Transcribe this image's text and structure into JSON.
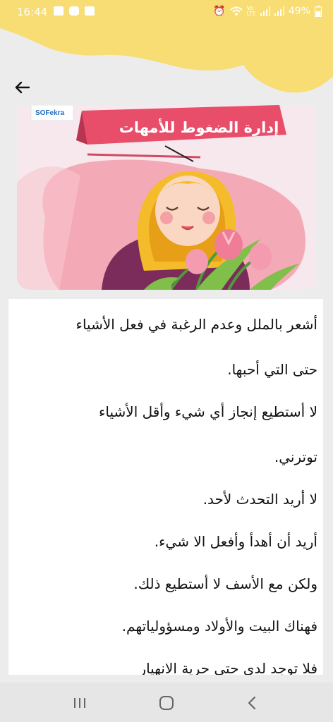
{
  "status_bar": {
    "time": "16:44",
    "battery": "49%",
    "icons": [
      "folder-icon",
      "message-icon",
      "image-icon",
      "alarm-icon",
      "wifi-icon",
      "volte-icon",
      "signal-icon",
      "signal-icon"
    ]
  },
  "header": {
    "back_icon": "arrow-left-icon",
    "accent_color": "#f7dd73"
  },
  "hero": {
    "title": "إدارة الضغوط للأمهات",
    "brand": "SOFekra",
    "banner_color": "#e84d6a"
  },
  "article": {
    "lines": [
      "أشعر بالملل وعدم الرغبة في فعل الأشياء",
      "حتى التي أحبها.",
      "لا أستطيع إنجاز أي شيء وأقل الأشياء",
      "توترني.",
      "لا أريد التحدث لأحد.",
      "أريد أن أهدأ وأفعل الا شيء.",
      "ولكن مع الأسف لا أستطيع ذلك.",
      "فهناك البيت والأولاد ومسؤولياتهم.",
      "فلا توجد لدي حتى حرية الانهيار"
    ]
  },
  "nav_bar": {
    "buttons": [
      "recents-icon",
      "home-icon",
      "back-icon"
    ]
  }
}
